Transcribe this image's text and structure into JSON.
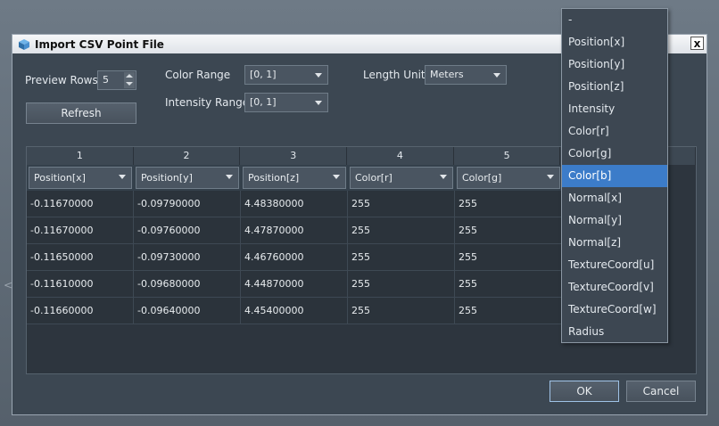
{
  "dialog": {
    "title": "Import CSV Point File",
    "close_glyph": "x"
  },
  "controls": {
    "preview_rows_label": "Preview Rows",
    "preview_rows_value": "5",
    "refresh_label": "Refresh",
    "color_range_label": "Color Range",
    "color_range_value": "[0, 1]",
    "intensity_range_label": "Intensity Range",
    "intensity_range_value": "[0, 1]",
    "length_unit_label": "Length Unit",
    "length_unit_value": "Meters"
  },
  "table": {
    "column_numbers": [
      "1",
      "2",
      "3",
      "4",
      "5"
    ],
    "column_mappings": [
      "Position[x]",
      "Position[y]",
      "Position[z]",
      "Color[r]",
      "Color[g]"
    ],
    "rows": [
      [
        "-0.11670000",
        "-0.09790000",
        "4.48380000",
        "255",
        "255"
      ],
      [
        "-0.11670000",
        "-0.09760000",
        "4.47870000",
        "255",
        "255"
      ],
      [
        "-0.11650000",
        "-0.09730000",
        "4.46760000",
        "255",
        "255"
      ],
      [
        "-0.11610000",
        "-0.09680000",
        "4.44870000",
        "255",
        "255"
      ],
      [
        "-0.11660000",
        "-0.09640000",
        "4.45400000",
        "255",
        "255"
      ]
    ]
  },
  "menu": {
    "items": [
      "-",
      "Position[x]",
      "Position[y]",
      "Position[z]",
      "Intensity",
      "Color[r]",
      "Color[g]",
      "Color[b]",
      "Normal[x]",
      "Normal[y]",
      "Normal[z]",
      "TextureCoord[u]",
      "TextureCoord[v]",
      "TextureCoord[w]",
      "Radius"
    ],
    "selected": "Color[b]"
  },
  "footer": {
    "ok_label": "OK",
    "cancel_label": "Cancel"
  },
  "desktop": {
    "arrow_glyph": "<"
  }
}
